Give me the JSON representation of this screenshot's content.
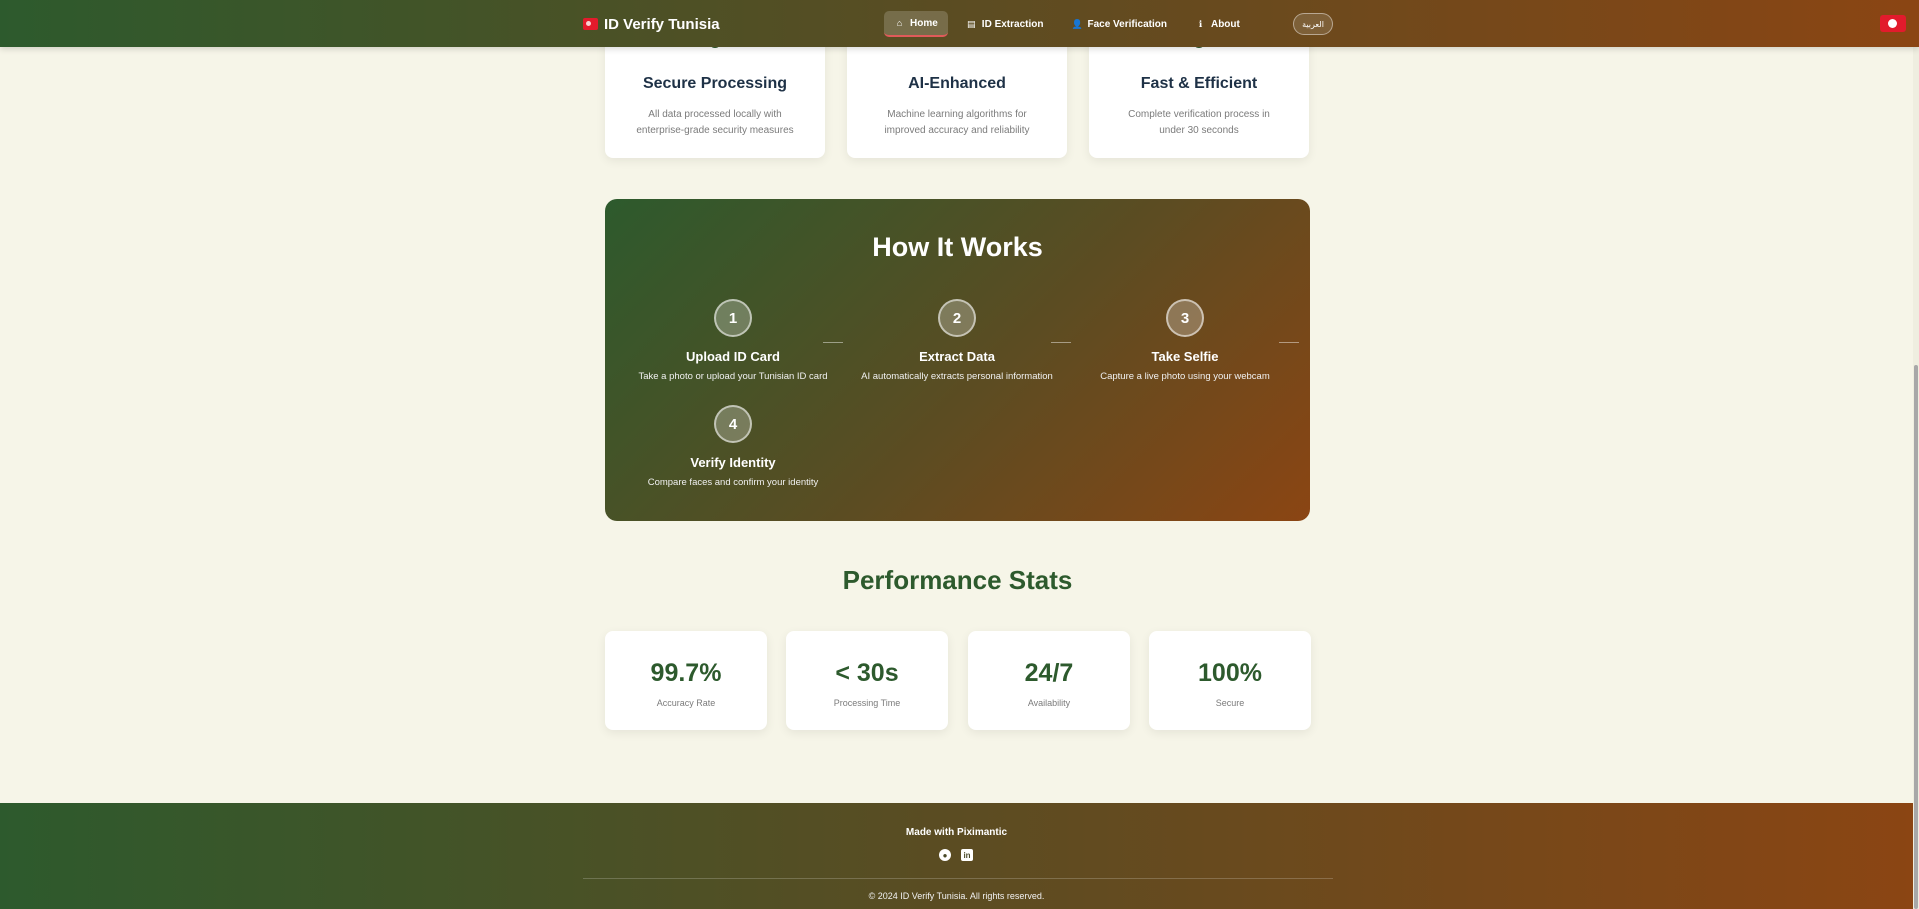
{
  "nav": {
    "brand": "ID Verify Tunisia",
    "links": [
      {
        "label": "Home",
        "icon": "home-icon"
      },
      {
        "label": "ID Extraction",
        "icon": "id-card-icon"
      },
      {
        "label": "Face Verification",
        "icon": "user-check-icon"
      },
      {
        "label": "About",
        "icon": "info-icon"
      }
    ],
    "language": "العربية"
  },
  "features": [
    {
      "title": "Secure Processing",
      "desc": "All data processed locally with enterprise-grade security measures"
    },
    {
      "title": "AI-Enhanced",
      "desc": "Machine learning algorithms for improved accuracy and reliability"
    },
    {
      "title": "Fast & Efficient",
      "desc": "Complete verification process in under 30 seconds"
    }
  ],
  "how": {
    "title": "How It Works",
    "steps": [
      {
        "num": "1",
        "title": "Upload ID Card",
        "desc": "Take a photo or upload your Tunisian ID card"
      },
      {
        "num": "2",
        "title": "Extract Data",
        "desc": "AI automatically extracts personal information"
      },
      {
        "num": "3",
        "title": "Take Selfie",
        "desc": "Capture a live photo using your webcam"
      },
      {
        "num": "4",
        "title": "Verify Identity",
        "desc": "Compare faces and confirm your identity"
      }
    ]
  },
  "performance": {
    "title": "Performance Stats",
    "stats": [
      {
        "value": "99.7%",
        "label": "Accuracy Rate"
      },
      {
        "value": "< 30s",
        "label": "Processing Time"
      },
      {
        "value": "24/7",
        "label": "Availability"
      },
      {
        "value": "100%",
        "label": "Secure"
      }
    ]
  },
  "footer": {
    "made_with": "Made with Piximantic",
    "copyright": "© 2024 ID Verify Tunisia. All rights reserved."
  },
  "colors": {
    "primary_green": "#2d5a2d",
    "brown": "#8b4513",
    "background": "#f6f5e8",
    "tunisia_red": "#e21b2c"
  }
}
